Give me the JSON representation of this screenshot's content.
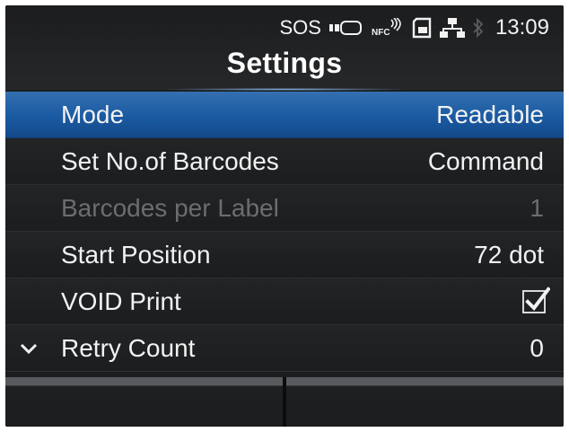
{
  "status": {
    "sos_label": "SOS",
    "time": "13:09",
    "icons": [
      "battery-icon",
      "nfc-icon",
      "sd-card-icon",
      "network-icon",
      "bluetooth-icon"
    ]
  },
  "header": {
    "title": "Settings"
  },
  "rows": [
    {
      "label": "Mode",
      "value": "Readable",
      "state": "selected"
    },
    {
      "label": "Set No.of Barcodes",
      "value": "Command",
      "state": "normal"
    },
    {
      "label": "Barcodes per Label",
      "value": "1",
      "state": "disabled"
    },
    {
      "label": "Start Position",
      "value": "72 dot",
      "state": "normal"
    },
    {
      "label": "VOID Print",
      "value_type": "checkbox",
      "checked": true,
      "state": "normal"
    },
    {
      "label": "Retry Count",
      "value": "0",
      "state": "normal"
    }
  ],
  "colors": {
    "selected_row": "#1a5aa2",
    "background": "#1b1d1f",
    "text": "#f2f2f2",
    "disabled_text": "#6b6d70"
  }
}
